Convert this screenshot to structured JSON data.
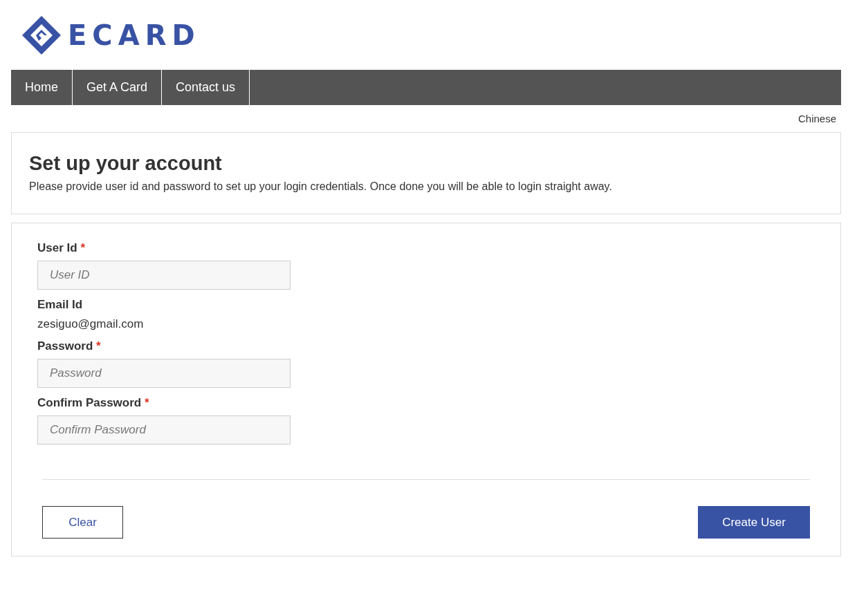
{
  "logo": {
    "text": "ECARD"
  },
  "nav": [
    {
      "label": "Home"
    },
    {
      "label": "Get A Card"
    },
    {
      "label": "Contact us"
    }
  ],
  "language_link": "Chinese",
  "intro": {
    "title": "Set up your account",
    "text": "Please provide user id and password to set up your login credentials. Once done you will be able to login straight away."
  },
  "form": {
    "fields": [
      {
        "kind": "input",
        "label": "User Id",
        "required_mark": "*",
        "placeholder": "User ID"
      },
      {
        "kind": "text",
        "label": "Email Id",
        "value": "zesiguo@gmail.com"
      },
      {
        "kind": "input",
        "label": "Password",
        "required_mark": "*",
        "placeholder": "Password"
      },
      {
        "kind": "input",
        "label": "Confirm Password",
        "required_mark": "*",
        "placeholder": "Confirm Password"
      }
    ],
    "buttons": [
      {
        "kind": "secondary",
        "label": "Clear"
      },
      {
        "kind": "primary",
        "label": "Create User"
      }
    ]
  }
}
